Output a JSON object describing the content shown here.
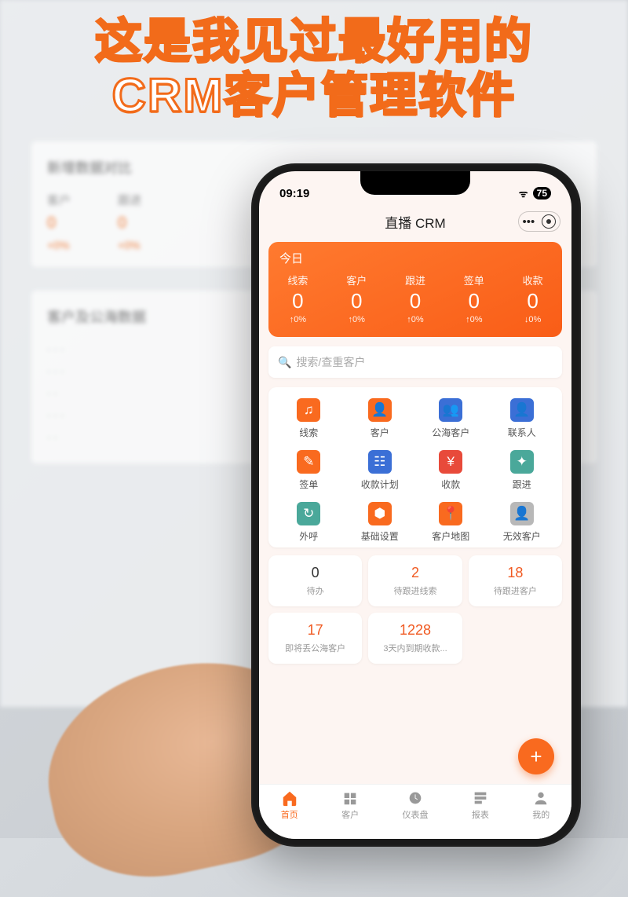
{
  "headline_l1": "这是我见过最好用的",
  "headline_l2": "CRM客户管理软件",
  "bg": {
    "section1_title": "新增数据对比",
    "section2_title": "客户及公海数据",
    "col1": "客户",
    "col2": "跟进",
    "val": "0",
    "delta": "+0%"
  },
  "status": {
    "time": "09:19",
    "battery": "75"
  },
  "app_title": "直播 CRM",
  "hero": {
    "period": "今日",
    "stats": [
      {
        "label": "线索",
        "value": "0",
        "delta": "↑0%"
      },
      {
        "label": "客户",
        "value": "0",
        "delta": "↑0%"
      },
      {
        "label": "跟进",
        "value": "0",
        "delta": "↑0%"
      },
      {
        "label": "签单",
        "value": "0",
        "delta": "↑0%"
      },
      {
        "label": "收款",
        "value": "0",
        "delta": "↓0%"
      }
    ]
  },
  "search_placeholder": "搜索/查重客户",
  "grid": [
    {
      "label": "线索",
      "color": "c-or",
      "glyph": "♫"
    },
    {
      "label": "客户",
      "color": "c-or",
      "glyph": "👤"
    },
    {
      "label": "公海客户",
      "color": "c-bl",
      "glyph": "👥"
    },
    {
      "label": "联系人",
      "color": "c-bl",
      "glyph": "👤"
    },
    {
      "label": "签单",
      "color": "c-or",
      "glyph": "✎"
    },
    {
      "label": "收款计划",
      "color": "c-bl",
      "glyph": "☷"
    },
    {
      "label": "收款",
      "color": "c-rd",
      "glyph": "¥"
    },
    {
      "label": "跟进",
      "color": "c-te",
      "glyph": "✦"
    },
    {
      "label": "外呼",
      "color": "c-te",
      "glyph": "↻"
    },
    {
      "label": "基础设置",
      "color": "c-or",
      "glyph": "⬢"
    },
    {
      "label": "客户地图",
      "color": "c-or",
      "glyph": "📍"
    },
    {
      "label": "无效客户",
      "color": "c-gy",
      "glyph": "👤"
    }
  ],
  "cards": [
    {
      "value": "0",
      "label": "待办",
      "hot": false
    },
    {
      "value": "2",
      "label": "待跟进线索",
      "hot": true
    },
    {
      "value": "18",
      "label": "待跟进客户",
      "hot": true
    },
    {
      "value": "17",
      "label": "即将丢公海客户",
      "hot": true
    },
    {
      "value": "1228",
      "label": "3天内到期收款...",
      "hot": true
    }
  ],
  "tabs": [
    {
      "label": "首页",
      "active": true
    },
    {
      "label": "客户",
      "active": false
    },
    {
      "label": "仪表盘",
      "active": false
    },
    {
      "label": "报表",
      "active": false
    },
    {
      "label": "我的",
      "active": false
    }
  ]
}
